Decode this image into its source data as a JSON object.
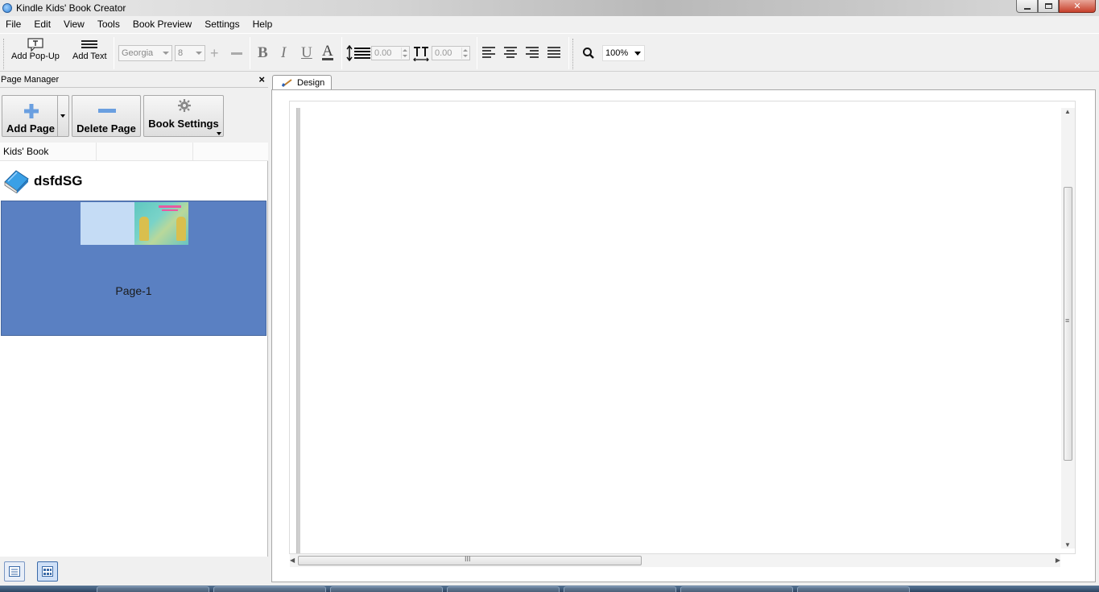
{
  "window": {
    "title": "Kindle Kids' Book Creator"
  },
  "menu": [
    "File",
    "Edit",
    "View",
    "Tools",
    "Book Preview",
    "Settings",
    "Help"
  ],
  "toolbar": {
    "add_popup_label": "Add Pop-Up",
    "add_text_label": "Add Text",
    "font_family": "Georgia",
    "font_size": "8",
    "bold": "B",
    "italic": "I",
    "underline": "U",
    "font_color": "A",
    "line_spacing_value": "0.00",
    "letter_spacing_value": "0.00",
    "zoom_value": "100%"
  },
  "page_manager": {
    "title": "Page Manager",
    "close_glyph": "×",
    "add_page_label": "Add Page",
    "delete_page_label": "Delete Page",
    "book_settings_label": "Book Settings",
    "column_header": "Kids' Book",
    "book_title": "dsfdSG",
    "pages": [
      {
        "label": "Page-1",
        "selected": true
      }
    ]
  },
  "design": {
    "tab_label": "Design",
    "hscroll_grip": "III",
    "vscroll_grip": "≡"
  },
  "colors": {
    "selected_page": "#5a80c2",
    "thumb_bg": "#c5dcf5",
    "close_button": "#c7402b"
  }
}
